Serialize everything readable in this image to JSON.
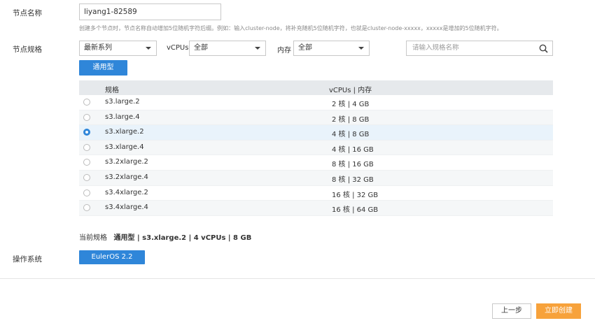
{
  "node_name": {
    "label": "节点名称",
    "value": "liyang1-82589",
    "hint": "创建多个节点时，节点名称自动增加5位随机字符后缀。例如：输入cluster-node，将补充随机5位随机字符，也就是cluster-node-xxxxx，xxxxx是增加的5位随机字符。"
  },
  "spec": {
    "label": "节点规格",
    "series_select": "最新系列",
    "vcpus_label": "vCPUs",
    "vcpus_select": "全部",
    "memory_label": "内存",
    "memory_select": "全部",
    "search_placeholder": "请输入规格名称",
    "type_button": "通用型",
    "columns": [
      "规格",
      "vCPUs | 内存"
    ],
    "rows": [
      {
        "name": "s3.large.2",
        "value": "2 核 | 4 GB",
        "selected": false
      },
      {
        "name": "s3.large.4",
        "value": "2 核 | 8 GB",
        "selected": false
      },
      {
        "name": "s3.xlarge.2",
        "value": "4 核 | 8 GB",
        "selected": true
      },
      {
        "name": "s3.xlarge.4",
        "value": "4 核 | 16 GB",
        "selected": false
      },
      {
        "name": "s3.2xlarge.2",
        "value": "8 核 | 16 GB",
        "selected": false
      },
      {
        "name": "s3.2xlarge.4",
        "value": "8 核 | 32 GB",
        "selected": false
      },
      {
        "name": "s3.4xlarge.2",
        "value": "16 核 | 32 GB",
        "selected": false
      },
      {
        "name": "s3.4xlarge.4",
        "value": "16 核 | 64 GB",
        "selected": false
      }
    ],
    "current_label": "当前规格",
    "current_value": "通用型 | s3.xlarge.2 | 4 vCPUs | 8 GB"
  },
  "os": {
    "label": "操作系统",
    "button": "EulerOS 2.2"
  },
  "footer": {
    "prev": "上一步",
    "create": "立即创建"
  },
  "colors": {
    "primary": "#2f86d9",
    "accent": "#f7a23b"
  }
}
